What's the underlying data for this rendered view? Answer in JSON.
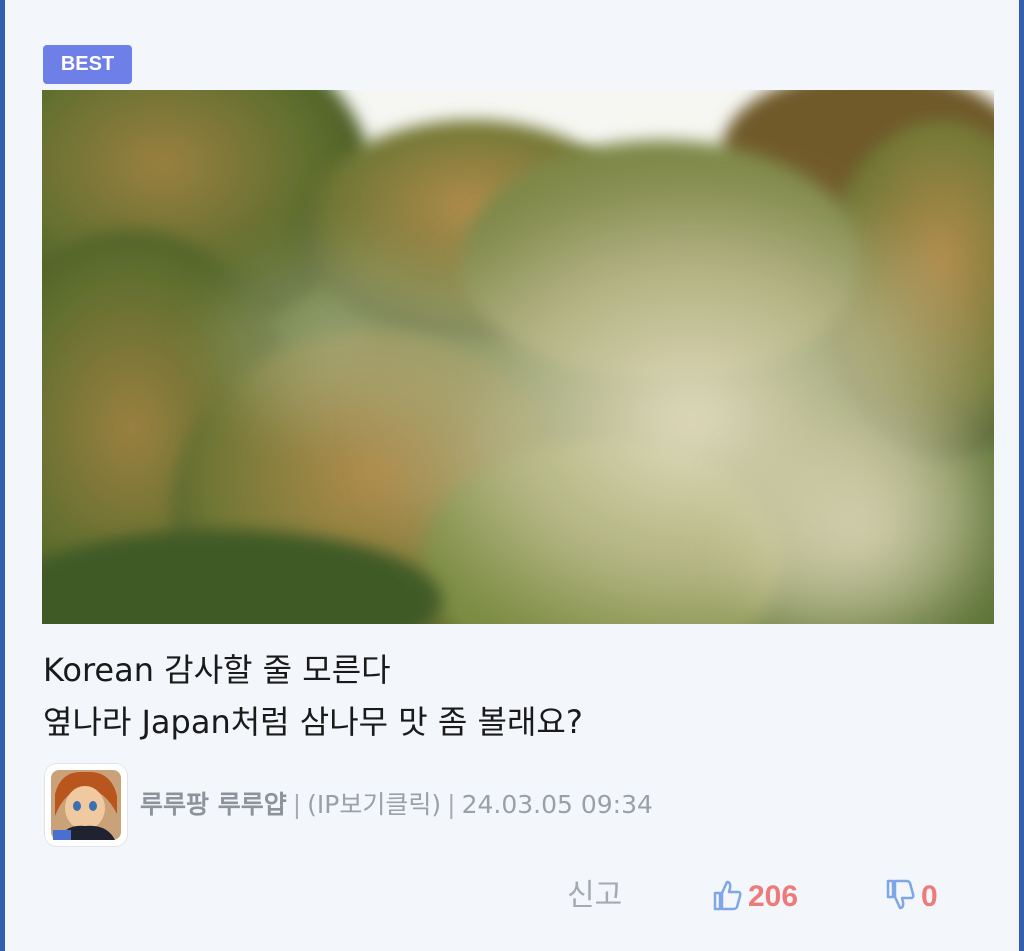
{
  "post": {
    "badge": "BEST",
    "image_alt": "Trees releasing clouds of pollen",
    "title_lines": [
      "Korean 감사할 줄 모른다",
      "옆나라 Japan처럼 삼나무 맛 좀 볼래요?"
    ],
    "author": "루루팡 루루얍",
    "separator": "|",
    "ip_link": "(IP보기클릭)",
    "timestamp": "24.03.05 09:34"
  },
  "actions": {
    "report_label": "신고",
    "like_count": "206",
    "dislike_count": "0"
  },
  "colors": {
    "badge": "#6f7fe8",
    "frame": "#2f5fae",
    "icon": "#7fa6e6",
    "count": "#ee7a7a"
  }
}
